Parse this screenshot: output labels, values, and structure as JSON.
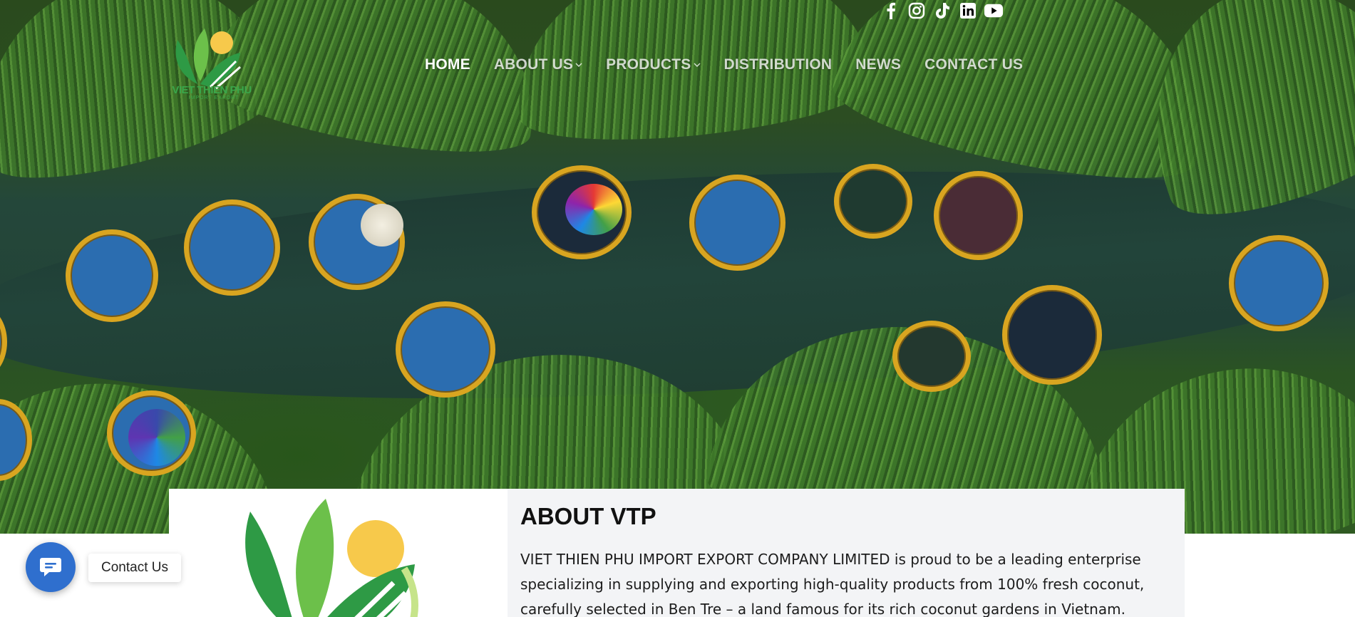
{
  "brand": {
    "name": "VIET THIEN PHU",
    "tagline": "IMPORT EXPORT",
    "green": "#3aa64a",
    "sun": "#f7c94b"
  },
  "header": {
    "social": [
      {
        "icon": "facebook-icon"
      },
      {
        "icon": "instagram-icon"
      },
      {
        "icon": "tiktok-icon"
      },
      {
        "icon": "linkedin-icon"
      },
      {
        "icon": "youtube-icon"
      }
    ],
    "nav": [
      {
        "label": "HOME",
        "active": true
      },
      {
        "label": "ABOUT US",
        "dropdown": true
      },
      {
        "label": "PRODUCTS",
        "dropdown": true
      },
      {
        "label": "DISTRIBUTION"
      },
      {
        "label": "NEWS"
      },
      {
        "label": "CONTACT US"
      }
    ]
  },
  "hero": {
    "image": "aerial view of basket boats on a river lined with coconut palms"
  },
  "about": {
    "title": "ABOUT VTP",
    "body": "VIET THIEN PHU IMPORT EXPORT COMPANY LIMITED is proud to be a leading enterprise specializing in supplying and exporting high-quality products from 100% fresh coconut, carefully selected in Ben Tre – a land famous for its rich coconut gardens in Vietnam."
  },
  "contact_widget": {
    "label": "Contact Us",
    "icon": "chat-icon",
    "color": "#2f6fce"
  }
}
